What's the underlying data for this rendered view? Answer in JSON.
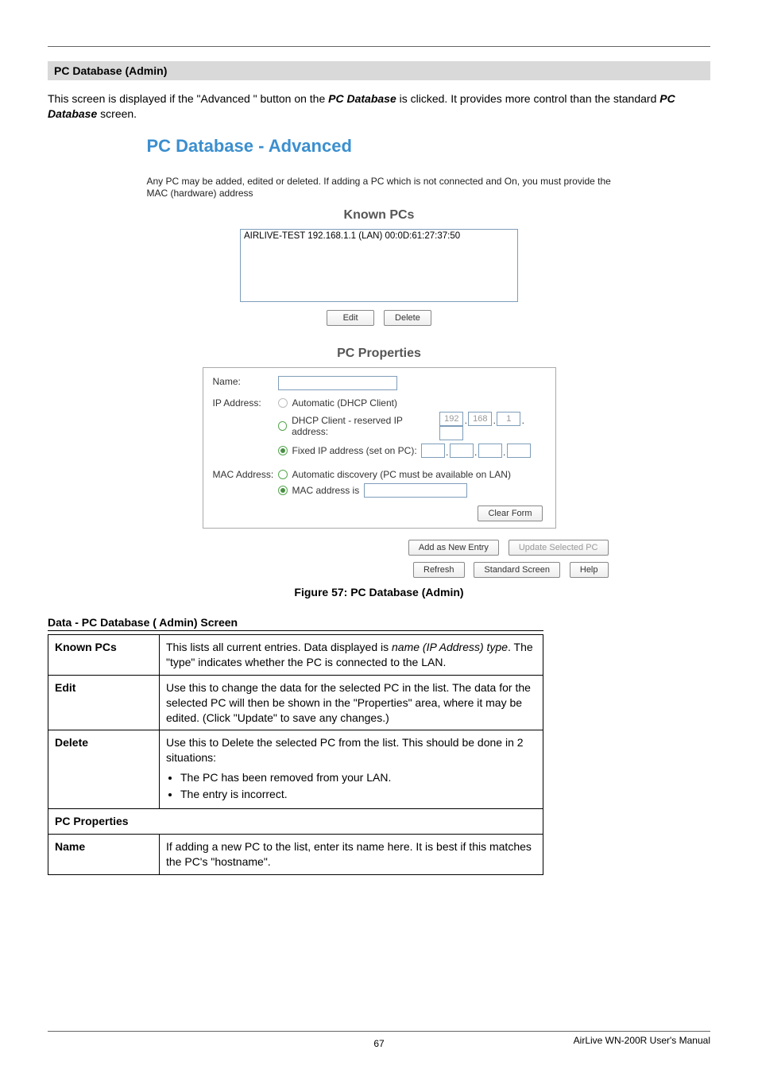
{
  "section_title": "PC Database (Admin)",
  "intro_a": "This screen is displayed if the \"Advanced \" button on the ",
  "intro_b": "PC Database",
  "intro_c": " is clicked. It provides more control than the standard ",
  "intro_d": "PC Database",
  "intro_e": " screen.",
  "ss": {
    "title": "PC Database - Advanced",
    "subtitle": "Any PC may be added, edited or deleted. If adding a PC which is not connected and On, you must provide the MAC (hardware) address",
    "known_pcs_heading": "Known PCs",
    "pc_entry": "AIRLIVE-TEST 192.168.1.1 (LAN) 00:0D:61:27:37:50",
    "edit_btn": "Edit",
    "delete_btn": "Delete",
    "pc_props_heading": "PC Properties",
    "name_label": "Name:",
    "ip_label": "IP Address:",
    "ip_opt1": "Automatic (DHCP Client)",
    "ip_opt2": "DHCP Client - reserved IP address:",
    "oct1": "192",
    "oct2": "168",
    "oct3": "1",
    "ip_opt3": "Fixed IP address (set on PC):",
    "mac_label": "MAC Address:",
    "mac_opt1": "Automatic discovery (PC must be available on LAN)",
    "mac_opt2": "MAC address is",
    "clear_form_btn": "Clear Form",
    "add_new_btn": "Add as New Entry",
    "update_btn": "Update Selected PC",
    "refresh_btn": "Refresh",
    "std_screen_btn": "Standard Screen",
    "help_btn": "Help"
  },
  "figure_caption": "Figure 57: PC Database (Admin)",
  "data_heading": "Data - PC Database ( Admin) Screen",
  "table": {
    "known_pcs_k": "Known PCs",
    "known_pcs_v_a": "This lists all current entries. Data displayed is ",
    "known_pcs_v_b": "name (IP Address) type",
    "known_pcs_v_c": ". The \"type\" indicates whether the PC is connected to the LAN.",
    "edit_k": "Edit",
    "edit_v": "Use this to change the data for the selected PC in the list. The data for the selected PC will then be shown in the \"Properties\" area, where it may be edited. (Click \"Update\" to save any changes.)",
    "delete_k": "Delete",
    "delete_v_intro": "Use this to Delete the selected PC from the list. This should be done in 2 situations:",
    "delete_li1": "The PC has been removed from your LAN.",
    "delete_li2": "The entry is incorrect.",
    "pc_props_section": "PC Properties",
    "name_k": "Name",
    "name_v": "If adding a new PC to the list, enter its name here. It is best if this matches the PC's \"hostname\"."
  },
  "footer": {
    "page": "67",
    "right": "AirLive WN-200R User's Manual"
  }
}
